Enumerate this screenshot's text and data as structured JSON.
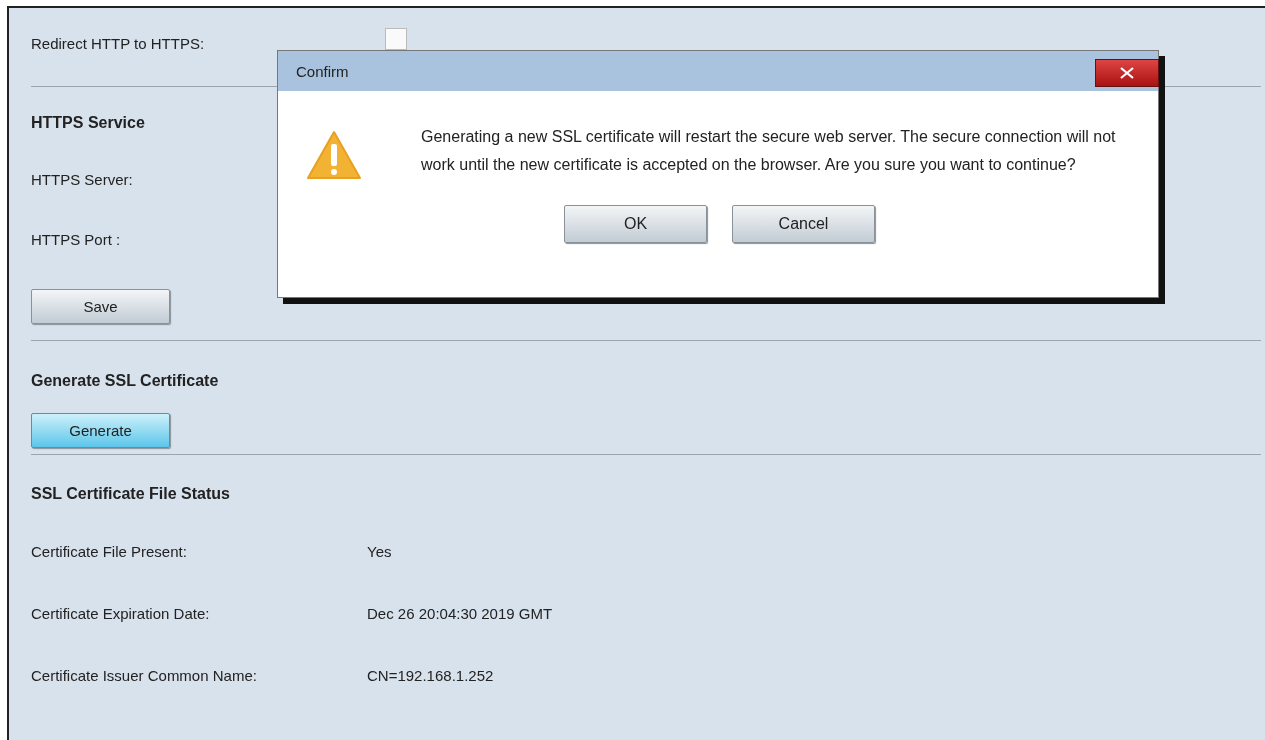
{
  "redirect": {
    "label": "Redirect HTTP to HTTPS:",
    "checked": false
  },
  "https_service": {
    "heading": "HTTPS Service",
    "fields": [
      {
        "label": "HTTPS Server:"
      },
      {
        "label": "HTTPS Port :"
      }
    ],
    "save_button": {
      "label": "Save",
      "focused": false
    }
  },
  "generate_section": {
    "heading": "Generate SSL Certificate",
    "button": {
      "label": "Generate",
      "focused": true
    }
  },
  "status_section": {
    "heading": "SSL Certificate File Status",
    "rows": [
      {
        "label": "Certificate File Present:",
        "value": "Yes"
      },
      {
        "label": "Certificate Expiration Date:",
        "value": "Dec 26 20:04:30 2019 GMT"
      },
      {
        "label": "Certificate Issuer Common Name:",
        "value": "CN=192.168.1.252"
      }
    ]
  },
  "dialog": {
    "title": "Confirm",
    "message": "Generating a new SSL certificate will restart the secure web server. The secure connection will not work until the new certificate is accepted on the browser. Are you sure you want to continue?",
    "buttons": [
      {
        "label": "OK"
      },
      {
        "label": "Cancel"
      }
    ]
  }
}
